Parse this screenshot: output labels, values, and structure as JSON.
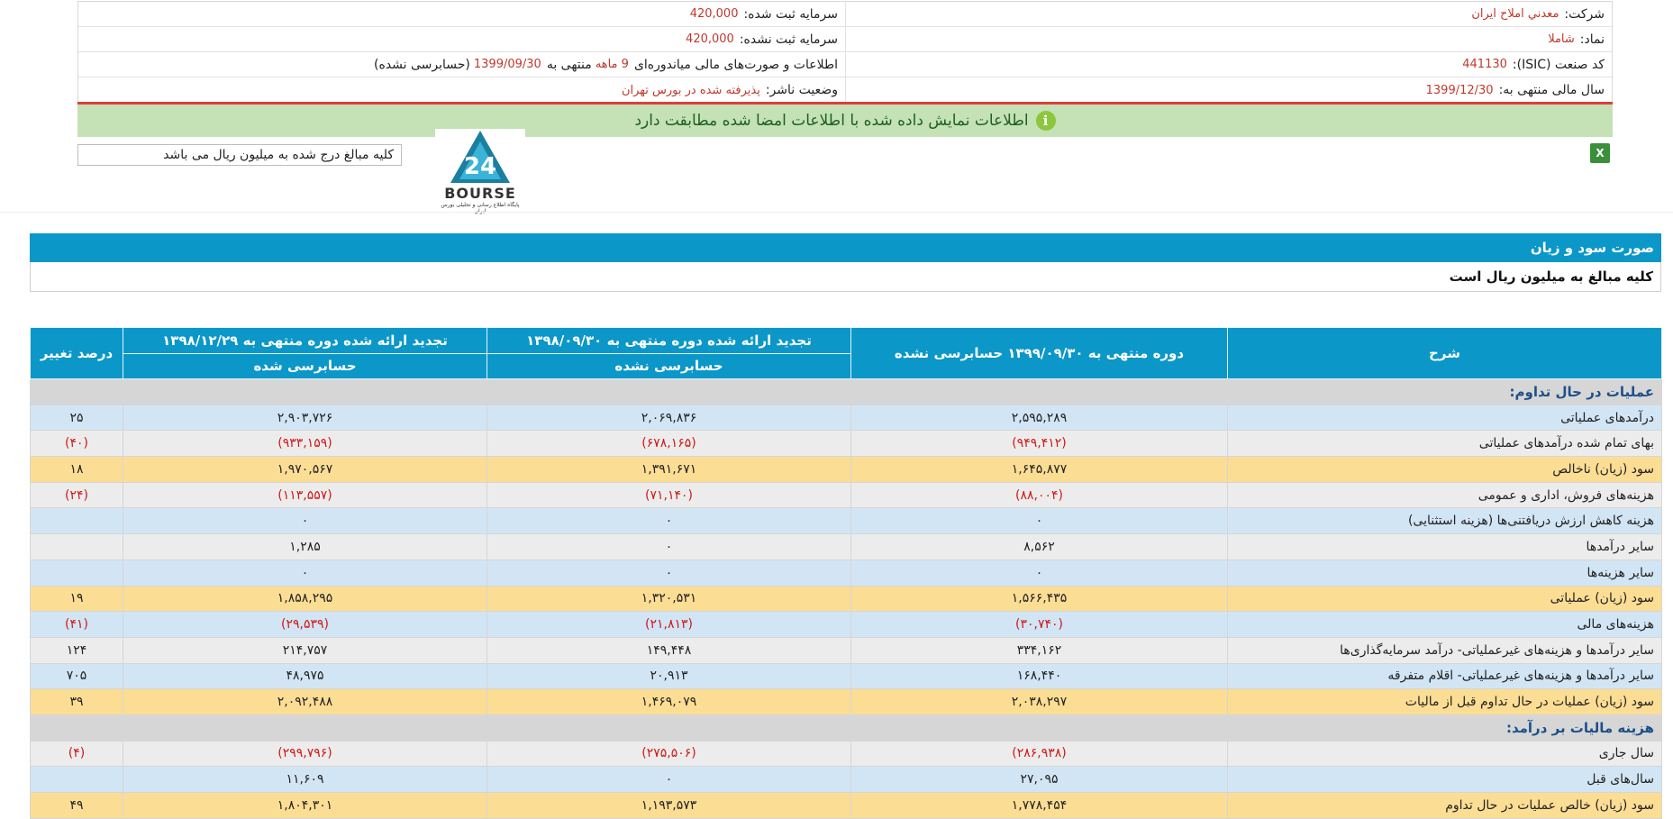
{
  "company_info": {
    "rows": [
      {
        "right_label": "شرکت:",
        "right_value": "معدني املاح ايران",
        "left_label": "سرمایه ثبت شده:",
        "left_value": "420,000"
      },
      {
        "right_label": "نماد:",
        "right_value": "شاملا",
        "left_label": "سرمایه ثبت نشده:",
        "left_value": "420,000"
      },
      {
        "right_label": "کد صنعت (ISIC):",
        "right_value": "441130",
        "left_label": "",
        "left_value": ""
      },
      {
        "right_label": "سال مالی منتهی به:",
        "right_value": "1399/12/30",
        "left_label": "وضعیت ناشر:",
        "left_value": "پذیرفته شده در بورس تهران"
      }
    ],
    "report_line": {
      "prefix": "اطلاعات و صورت‌های مالی میاندوره‌ای",
      "months": "9 ماهه",
      "middle": "منتهی به",
      "date": "1399/09/30",
      "suffix": "(حسابرسی نشده)"
    }
  },
  "banner": {
    "text": "اطلاعات نمایش داده شده با اطلاعات امضا شده مطابقت دارد",
    "icon": "info-icon",
    "color": "#c4e2b5"
  },
  "units_note": "کلیه مبالغ درج شده به میلیون ریال می باشد",
  "logo": {
    "word": "BOURSE",
    "sub": "پایگاه اطلاع رسانی و تحلیلی بورس ایران"
  },
  "toolbar": {
    "excel_icon": "excel-icon"
  },
  "section": {
    "title": "صورت سود و زیان",
    "note": "کلیه مبالغ به میلیون ریال است"
  },
  "table": {
    "headers": {
      "desc": "شرح",
      "col1": "دوره منتهی به ۱۳۹۹/۰۹/۳۰ حسابرسی نشده",
      "col2": "تجدید ارائه شده دوره منتهی به ۱۳۹۸/۰۹/۳۰",
      "col2_sub": "حسابرسی نشده",
      "col3": "تجدید ارائه شده دوره منتهی به ۱۳۹۸/۱۲/۲۹",
      "col3_sub": "حسابرسی شده",
      "col4": "درصد تغییر"
    },
    "rows": [
      {
        "style": "head",
        "desc": "عملیات در حال تداوم:",
        "c1": "",
        "c2": "",
        "c3": "",
        "c4": ""
      },
      {
        "style": "blue",
        "desc": "درآمدهای عملیاتی",
        "c1": "۲,۵۹۵,۲۸۹",
        "c2": "۲,۰۶۹,۸۳۶",
        "c3": "۲,۹۰۳,۷۲۶",
        "c4": "۲۵"
      },
      {
        "style": "gray",
        "desc": "بهای تمام شده درآمدهای عملیاتی",
        "c1": "(۹۴۹,۴۱۲)",
        "c2": "(۶۷۸,۱۶۵)",
        "c3": "(۹۳۳,۱۵۹)",
        "c4": "(۴۰)"
      },
      {
        "style": "yellow",
        "desc": "سود (زیان) ناخالص",
        "c1": "۱,۶۴۵,۸۷۷",
        "c2": "۱,۳۹۱,۶۷۱",
        "c3": "۱,۹۷۰,۵۶۷",
        "c4": "۱۸"
      },
      {
        "style": "gray",
        "desc": "هزینه‌های فروش، اداری و عمومی",
        "c1": "(۸۸,۰۰۴)",
        "c2": "(۷۱,۱۴۰)",
        "c3": "(۱۱۳,۵۵۷)",
        "c4": "(۲۴)"
      },
      {
        "style": "blue",
        "desc": "هزینه کاهش ارزش دریافتنی‌ها (هزینه استثنایی)",
        "c1": "۰",
        "c2": "۰",
        "c3": "۰",
        "c4": ""
      },
      {
        "style": "gray",
        "desc": "سایر درآمدها",
        "c1": "۸,۵۶۲",
        "c2": "۰",
        "c3": "۱,۲۸۵",
        "c4": ""
      },
      {
        "style": "blue",
        "desc": "سایر هزینه‌ها",
        "c1": "۰",
        "c2": "۰",
        "c3": "۰",
        "c4": ""
      },
      {
        "style": "yellow",
        "desc": "سود (زیان) عملیاتی",
        "c1": "۱,۵۶۶,۴۳۵",
        "c2": "۱,۳۲۰,۵۳۱",
        "c3": "۱,۸۵۸,۲۹۵",
        "c4": "۱۹"
      },
      {
        "style": "blue",
        "desc": "هزینه‌های مالی",
        "c1": "(۳۰,۷۴۰)",
        "c2": "(۲۱,۸۱۳)",
        "c3": "(۲۹,۵۳۹)",
        "c4": "(۴۱)"
      },
      {
        "style": "gray",
        "desc": "سایر درآمدها و هزینه‌های غیرعملیاتی- درآمد سرمایه‌گذاری‌ها",
        "c1": "۳۳۴,۱۶۲",
        "c2": "۱۴۹,۴۴۸",
        "c3": "۲۱۴,۷۵۷",
        "c4": "۱۲۴"
      },
      {
        "style": "blue",
        "desc": "سایر درآمدها و هزینه‌های غیرعملیاتی- اقلام متفرقه",
        "c1": "۱۶۸,۴۴۰",
        "c2": "۲۰,۹۱۳",
        "c3": "۴۸,۹۷۵",
        "c4": "۷۰۵"
      },
      {
        "style": "yellow",
        "desc": "سود (زیان) عملیات در حال تداوم قبل از مالیات",
        "c1": "۲,۰۳۸,۲۹۷",
        "c2": "۱,۴۶۹,۰۷۹",
        "c3": "۲,۰۹۲,۴۸۸",
        "c4": "۳۹"
      },
      {
        "style": "head",
        "desc": "هزینه مالیات بر درآمد:",
        "c1": "",
        "c2": "",
        "c3": "",
        "c4": ""
      },
      {
        "style": "gray",
        "desc": "سال جاری",
        "c1": "(۲۸۶,۹۳۸)",
        "c2": "(۲۷۵,۵۰۶)",
        "c3": "(۲۹۹,۷۹۶)",
        "c4": "(۴)"
      },
      {
        "style": "blue",
        "desc": "سال‌های قبل",
        "c1": "۲۷,۰۹۵",
        "c2": "۰",
        "c3": "۱۱,۶۰۹",
        "c4": ""
      },
      {
        "style": "yellow",
        "desc": "سود (زیان) خالص عملیات در حال تداوم",
        "c1": "۱,۷۷۸,۴۵۴",
        "c2": "۱,۱۹۳,۵۷۳",
        "c3": "۱,۸۰۴,۳۰۱",
        "c4": "۴۹"
      }
    ]
  }
}
